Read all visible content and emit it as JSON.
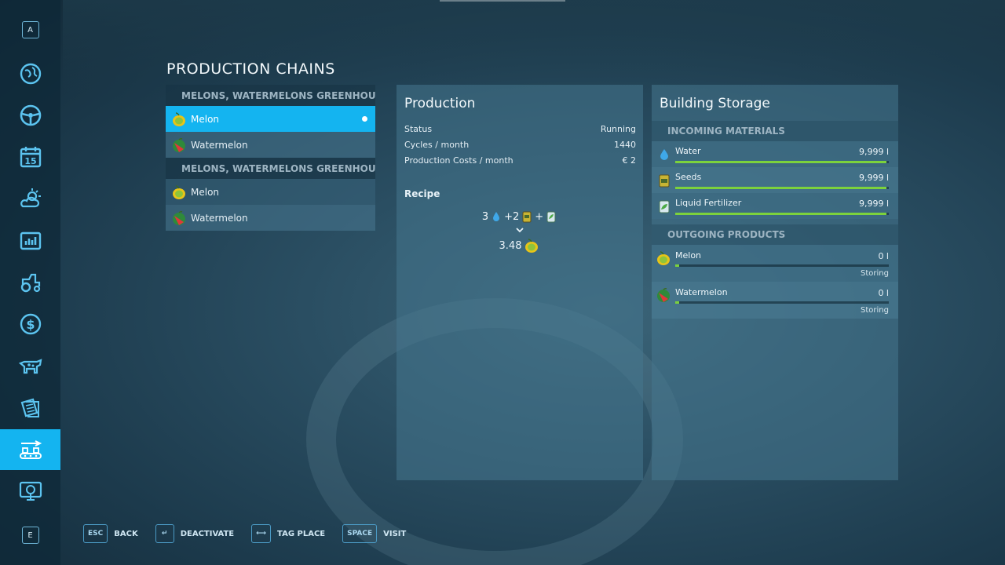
{
  "page_title": "PRODUCTION CHAINS",
  "sidebar": {
    "top_key": "A",
    "bottom_key": "E",
    "calendar_day": "15",
    "items": [
      {
        "icon": "map-globe-icon"
      },
      {
        "icon": "steering-wheel-icon"
      },
      {
        "icon": "calendar-icon"
      },
      {
        "icon": "weather-icon"
      },
      {
        "icon": "statistics-icon"
      },
      {
        "icon": "tractor-icon"
      },
      {
        "icon": "dollar-icon"
      },
      {
        "icon": "animals-icon"
      },
      {
        "icon": "contracts-icon"
      },
      {
        "icon": "production-icon",
        "active": true
      },
      {
        "icon": "tutorial-screen-icon"
      }
    ]
  },
  "chains": [
    {
      "group": "MELONS, WATERMELONS GREENHOUSE",
      "items": [
        {
          "label": "Melon",
          "selected": true
        },
        {
          "label": "Watermelon"
        }
      ]
    },
    {
      "group": "MELONS, WATERMELONS GREENHOUSE",
      "items": [
        {
          "label": "Melon"
        },
        {
          "label": "Watermelon"
        }
      ]
    }
  ],
  "production": {
    "title": "Production",
    "rows": [
      {
        "label": "Status",
        "value": "Running"
      },
      {
        "label": "Cycles / month",
        "value": "1440"
      },
      {
        "label": "Production Costs / month",
        "value": "€ 2"
      }
    ],
    "recipe_label": "Recipe",
    "recipe_in_1": "3",
    "recipe_in_2": "+2",
    "recipe_plus": "+",
    "recipe_output": "3.48"
  },
  "storage": {
    "title": "Building Storage",
    "incoming_header": "INCOMING MATERIALS",
    "incoming": [
      {
        "name": "Water",
        "amount": "9,999 l",
        "fill": 0.99,
        "icon": "water-drop-icon"
      },
      {
        "name": "Seeds",
        "amount": "9,999 l",
        "fill": 0.99,
        "icon": "seed-bag-icon"
      },
      {
        "name": "Liquid Fertilizer",
        "amount": "9,999 l",
        "fill": 0.99,
        "icon": "fertilizer-icon"
      }
    ],
    "outgoing_header": "OUTGOING PRODUCTS",
    "outgoing": [
      {
        "name": "Melon",
        "amount": "0 l",
        "mode": "Storing",
        "fill": 0.0
      },
      {
        "name": "Watermelon",
        "amount": "0 l",
        "mode": "Storing",
        "fill": 0.0
      }
    ]
  },
  "footer": [
    {
      "key": "ESC",
      "label": "BACK"
    },
    {
      "key": "↵",
      "label": "DEACTIVATE"
    },
    {
      "key": "⟷",
      "label": "TAG PLACE"
    },
    {
      "key": "SPACE",
      "label": "VISIT"
    }
  ],
  "colors": {
    "accent": "#14b4f0",
    "bar": "#7cd23c"
  }
}
